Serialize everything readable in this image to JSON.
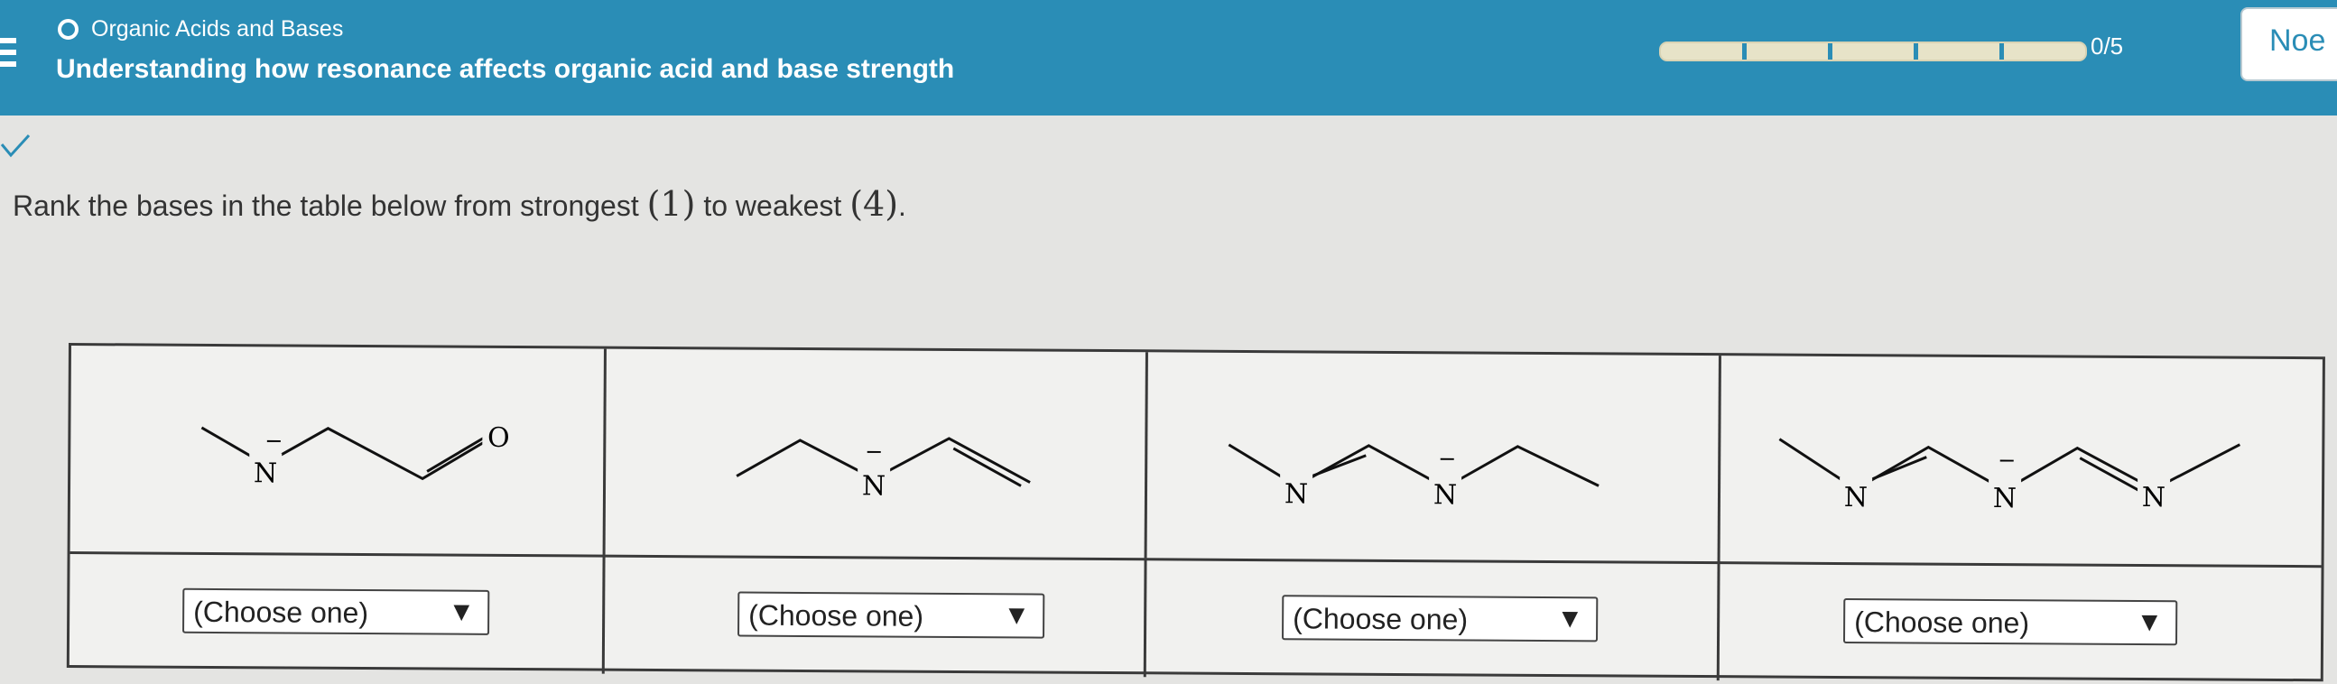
{
  "header": {
    "topic": "Organic Acids and Bases",
    "subtitle": "Understanding how resonance affects organic acid and base strength",
    "progress": {
      "completed": 0,
      "total": 5
    },
    "score": "0/5",
    "next_label": "Noe"
  },
  "prompt": {
    "before": "Rank the bases in the table below from strongest ",
    "n1": "(1)",
    "middle": " to weakest ",
    "n4": "(4)",
    "after": "."
  },
  "bases": [
    {
      "labels": {
        "n": "N",
        "o": "O",
        "charge": "−"
      },
      "select": {
        "value": "(Choose one)"
      }
    },
    {
      "labels": {
        "n": "N",
        "charge": "−"
      },
      "select": {
        "value": "(Choose one)"
      }
    },
    {
      "labels": {
        "n1": "N",
        "n2": "N",
        "charge": "−"
      },
      "select": {
        "value": "(Choose one)"
      }
    },
    {
      "labels": {
        "n1": "N",
        "n2": "N",
        "n3": "N",
        "charge": "−"
      },
      "select": {
        "value": "(Choose one)"
      }
    }
  ],
  "colors": {
    "header": "#2a8db6",
    "background": "#e4e4e2",
    "table": "#f1f1ef"
  },
  "icons": {
    "menu": "hamburger-icon",
    "status": "checkmark-icon",
    "topic_marker": "circle-icon",
    "dropdown": "triangle-down-icon"
  }
}
